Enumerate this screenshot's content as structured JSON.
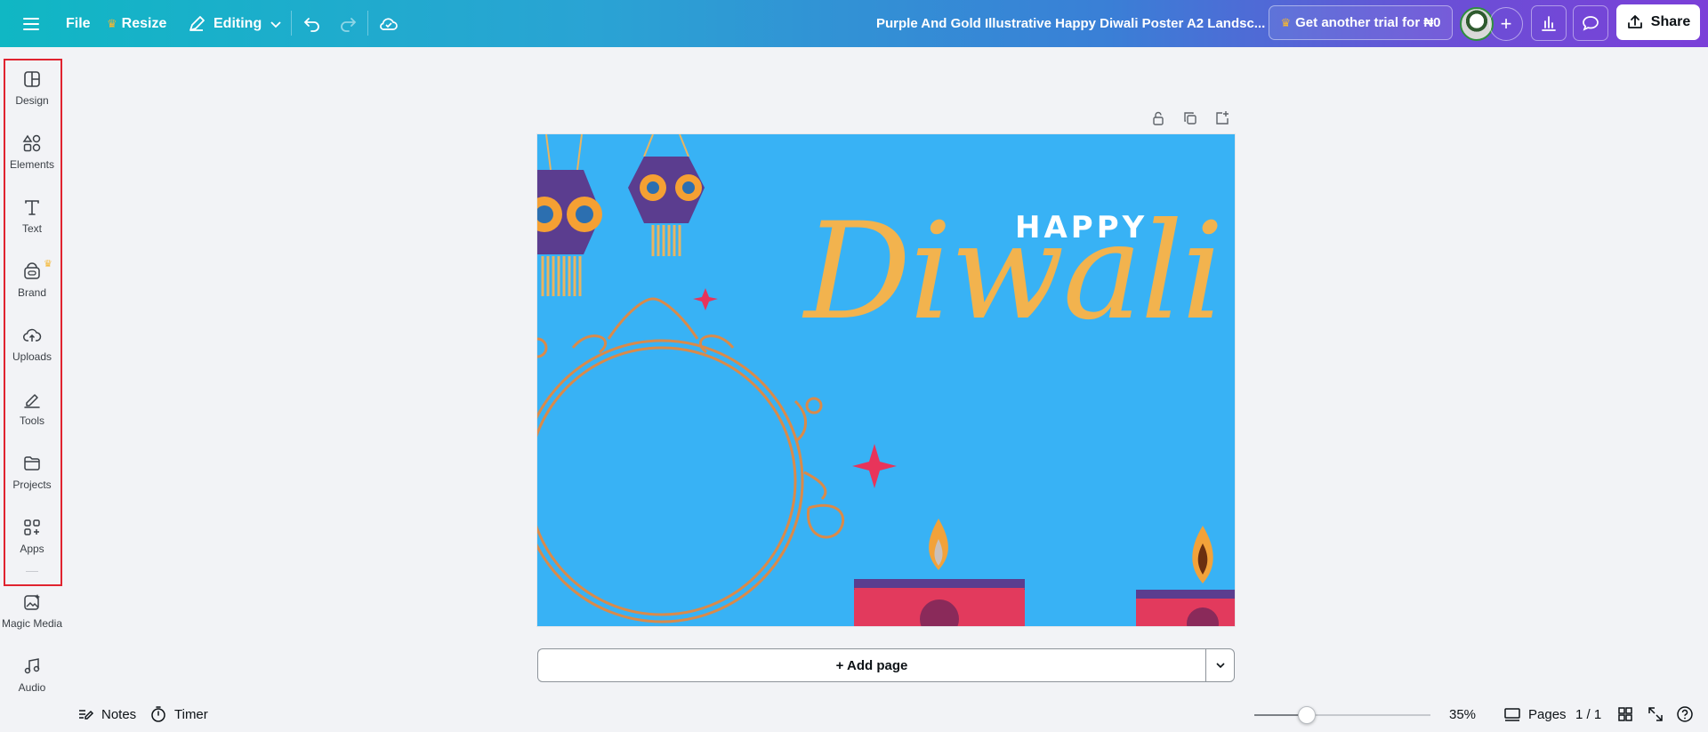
{
  "topbar": {
    "file_label": "File",
    "resize_label": "Resize",
    "editing_label": "Editing",
    "doc_title": "Purple And Gold Illustrative Happy Diwali Poster A2 Landsc...",
    "trial_label": "Get another trial for ₦0",
    "share_label": "Share"
  },
  "sidebar": {
    "items": [
      {
        "label": "Design",
        "icon": "design-icon"
      },
      {
        "label": "Elements",
        "icon": "elements-icon"
      },
      {
        "label": "Text",
        "icon": "text-icon"
      },
      {
        "label": "Brand",
        "icon": "brand-icon"
      },
      {
        "label": "Uploads",
        "icon": "uploads-icon"
      },
      {
        "label": "Tools",
        "icon": "tools-icon"
      },
      {
        "label": "Projects",
        "icon": "projects-icon"
      },
      {
        "label": "Apps",
        "icon": "apps-icon"
      },
      {
        "label": "Magic Media",
        "icon": "magic-media-icon"
      },
      {
        "label": "Audio",
        "icon": "audio-icon"
      }
    ]
  },
  "canvas": {
    "happy_text": "HAPPY",
    "diwali_text": "Diwali",
    "bg_color": "#38b2f5",
    "accent_gold": "#f2b34e",
    "accent_red": "#e8345a"
  },
  "add_page_label": "+ Add page",
  "bottombar": {
    "notes_label": "Notes",
    "timer_label": "Timer",
    "zoom_label": "35%",
    "zoom_level": 0.3,
    "pages_label": "Pages",
    "page_count": "1 / 1"
  },
  "colors": {
    "highlight": "#e0232f",
    "crown": "#f5b731"
  }
}
